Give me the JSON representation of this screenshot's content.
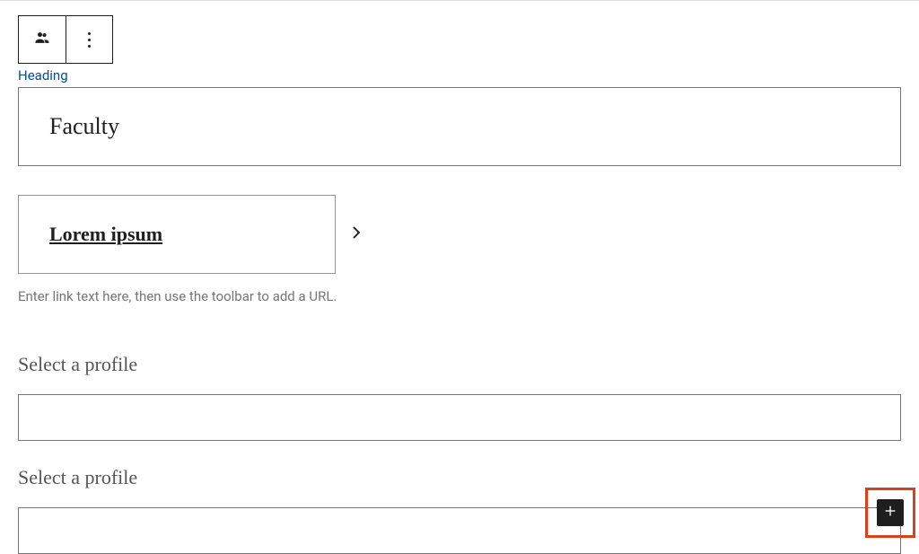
{
  "block": {
    "heading_label": "Heading",
    "heading_value": "Faculty",
    "link_text": "Lorem ipsum",
    "link_hint": "Enter link text here, then use the toolbar to add a URL.",
    "profile_label_1": "Select a profile",
    "profile_label_2": "Select a profile"
  },
  "icons": {
    "block_type": "people-icon",
    "options": "more-options-icon",
    "chevron": "chevron-right-icon",
    "add": "plus-icon"
  }
}
